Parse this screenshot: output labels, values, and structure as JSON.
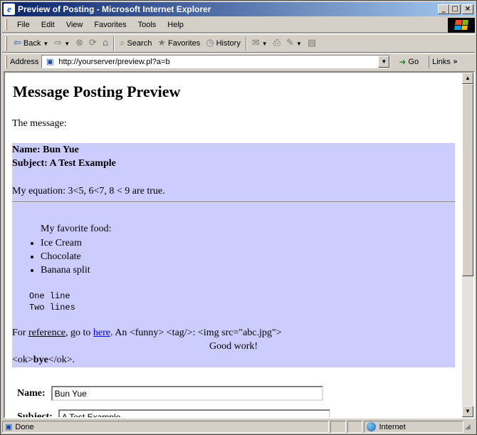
{
  "window": {
    "title": "Preview of Posting - Microsoft Internet Explorer",
    "controls": {
      "minimize": "_",
      "maximize": "□",
      "close": "×"
    }
  },
  "menu": [
    "File",
    "Edit",
    "View",
    "Favorites",
    "Tools",
    "Help"
  ],
  "toolbar": {
    "back_label": "Back",
    "search_label": "Search",
    "favorites_label": "Favorites",
    "history_label": "History"
  },
  "address": {
    "label": "Address",
    "url": "http://yourserver/preview.pl?a=b",
    "go_label": "Go",
    "links_label": "Links"
  },
  "page": {
    "heading": "Message Posting Preview",
    "intro": "The message:",
    "message": {
      "name_line": "Name: Bun Yue",
      "subject_line": "Subject: A Test Example",
      "equation": "My equation: 3<5, 6<7, 8 < 9 are true.",
      "food_title": "My favorite food:",
      "foods": [
        "Ice Cream",
        "Chocolate",
        "Banana split"
      ],
      "pre_lines": "One line\nTwo lines",
      "ref_prefix": "For ",
      "ref_word": "reference",
      "ref_middle": ", go to ",
      "ref_link": "here",
      "ref_suffix": ". An <funny> <tag/>: <img src=\"abc.jpg\">",
      "good_work": "Good work!",
      "ok_prefix": "<ok>",
      "ok_bold": "bye",
      "ok_suffix": "</ok>."
    },
    "form": {
      "name_label": "Name:",
      "name_value": "Bun Yue",
      "subject_label": "Subject:",
      "subject_value": "A Test Example"
    }
  },
  "status": {
    "text": "Done",
    "zone": "Internet"
  },
  "icons": {
    "app": "ie-logo-icon",
    "back": "back-arrow-icon",
    "forward": "forward-arrow-icon",
    "stop": "stop-icon",
    "refresh": "refresh-icon",
    "home": "home-icon",
    "search": "search-icon",
    "favorites": "favorites-icon",
    "history": "history-icon",
    "mail": "mail-icon",
    "print": "print-icon",
    "edit": "edit-icon",
    "discuss": "discuss-icon",
    "go": "go-arrow-icon",
    "page": "page-icon",
    "zone": "globe-icon"
  }
}
